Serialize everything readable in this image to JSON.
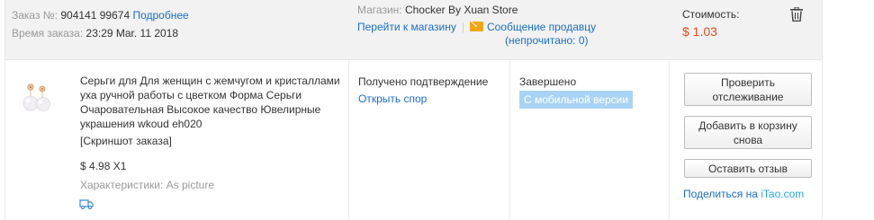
{
  "order": {
    "number_label": "Заказ №:",
    "number_value": "904141   99674",
    "details_link": "Подробнее",
    "time_label": "Время заказа:",
    "time_value": "23:29 Mar. 11 2018"
  },
  "store": {
    "label": "Магазин:",
    "name": "Chocker By Xuan Store",
    "goto_link": "Перейти к магазину",
    "separator": "|",
    "message_link": "Сообщение продавцу",
    "message_unread": "(непрочитано: 0)"
  },
  "cost": {
    "label": "Стоимость:",
    "value": "$ 1.03"
  },
  "product": {
    "title": "Серьги для Для женщин с жемчугом и кристаллами уха ручной работы с цветком Форма Серьги Очаровательная Высокое качество Ювелирные украшения wkoud eh020",
    "snapshot": "[Скриншот заказа]",
    "price": "$ 4.98 X1",
    "attributes": "Характеристики: As picture"
  },
  "status": {
    "confirmation": "Получено подтверждение",
    "dispute_link": "Открыть спор",
    "state": "Завершено",
    "mobile_badge": "С мобильной версии"
  },
  "actions": {
    "track": "Проверить отслеживание",
    "add_to_cart": "Добавить в корзину снова",
    "review": "Оставить отзыв",
    "share_prefix": "Поделиться на ",
    "share_brand": "iTao.com"
  },
  "icons": {
    "trash": "trash-icon",
    "message": "envelope-icon",
    "shipping": "truck-icon"
  },
  "colors": {
    "link": "#1a6fc9",
    "price": "#e4491e",
    "badge": "#a9d3f5",
    "message_icon": "#f3a512"
  }
}
